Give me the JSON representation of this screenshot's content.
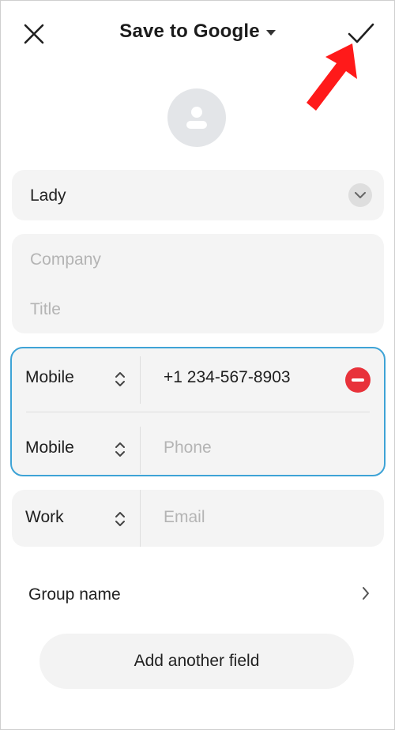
{
  "header": {
    "title": "Save to Google",
    "close_icon": "close-icon",
    "dropdown_icon": "caret-down-icon",
    "confirm_icon": "checkmark-icon"
  },
  "annotation": {
    "icon": "red-arrow-pointer",
    "color": "#ff1a1a"
  },
  "avatar": {
    "icon": "person-icon"
  },
  "name_field": {
    "value": "Lady",
    "expand_icon": "chevron-down-icon"
  },
  "organization": {
    "company_placeholder": "Company",
    "title_placeholder": "Title"
  },
  "phones": [
    {
      "type": "Mobile",
      "value": "+1 234-567-8903",
      "remove_icon": "remove-circle-icon"
    },
    {
      "type": "Mobile",
      "placeholder": "Phone"
    }
  ],
  "email": {
    "type": "Work",
    "placeholder": "Email"
  },
  "group": {
    "label": "Group name",
    "chevron_icon": "chevron-right-icon"
  },
  "add_field": {
    "label": "Add another field"
  },
  "colors": {
    "accent_border": "#3ea3d6",
    "remove_red": "#e8323a",
    "card_bg": "#f4f4f4",
    "placeholder": "#b4b4b4"
  }
}
